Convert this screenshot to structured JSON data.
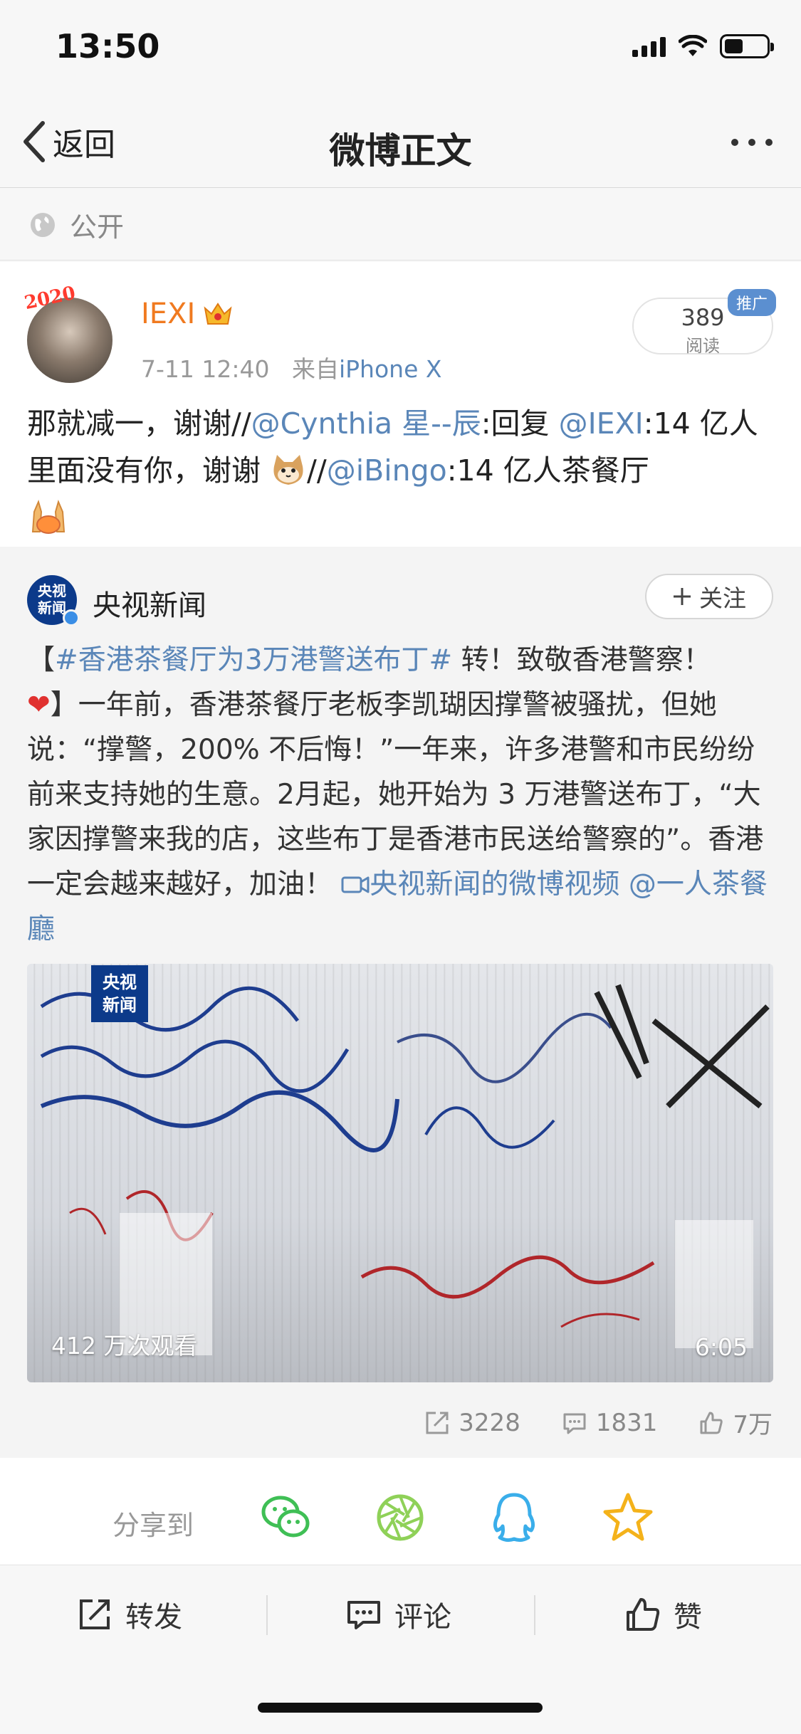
{
  "status_bar": {
    "time": "13:50"
  },
  "nav": {
    "back_label": "返回",
    "title": "微博正文"
  },
  "visibility": {
    "label": "公开"
  },
  "post": {
    "avatar_badge": "2020",
    "username": "IEXI",
    "time": "7-11 12:40",
    "source_prefix": "来自",
    "source": "iPhone X",
    "read_count": "389",
    "read_label": "阅读",
    "promo_tag": "推广",
    "text_parts": {
      "p1": "那就减一，谢谢//",
      "m1": "@Cynthia 星--辰",
      "p2": ":回复 ",
      "m2": "@IEXI",
      "p3": ":14 亿人里面没有你，谢谢 ",
      "p4": "//",
      "m3": "@iBingo",
      "p5": ":14 亿人茶餐厅"
    }
  },
  "repost": {
    "author": "央视新闻",
    "avatar_text_1": "央视",
    "avatar_text_2": "新闻",
    "follow_label": "关注",
    "text_parts": {
      "b1": "【",
      "hashtag": "#香港茶餐厅为3万港警送布丁#",
      "t1": " 转！致敬香港警察！",
      "heart": "❤",
      "t2": "】一年前，香港茶餐厅老板李凯瑚因撑警被骚扰，但她说：“撑警，200% 不后悔！”一年来，许多港警和市民纷纷前来支持她的生意。2月起，她开始为 3 万港警送布丁，“大家因撑警来我的店，这些布丁是香港市民送给警察的”。香港一定会越来越好，加油！ ",
      "video_link": "央视新闻的微博视频",
      "space": " ",
      "mention": "@一人茶餐廳"
    },
    "video": {
      "views": "412 万次观看",
      "duration": "6:05",
      "logo_1": "央视",
      "logo_2": "新闻"
    },
    "actions": {
      "reposts": "3228",
      "comments": "1831",
      "likes": "7万"
    }
  },
  "share": {
    "label": "分享到"
  },
  "bottom_bar": {
    "repost": "转发",
    "comment": "评论",
    "like": "赞"
  }
}
